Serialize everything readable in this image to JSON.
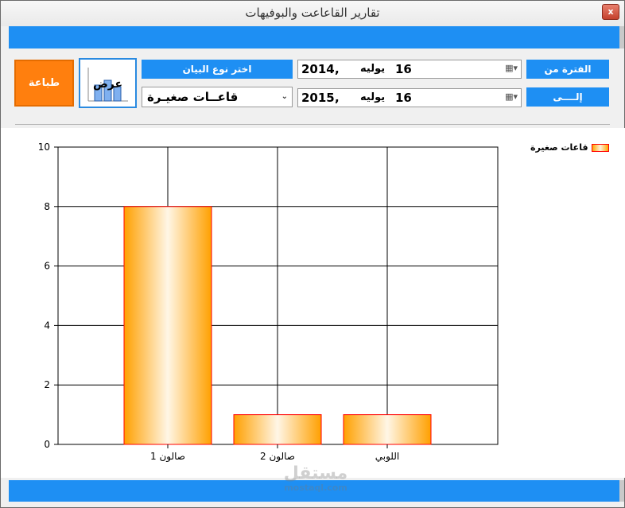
{
  "window": {
    "title": "تقارير القاعاعت والبوفيهات",
    "close_label": "x"
  },
  "toolbar": {
    "print_label": "طباعة",
    "show_label": "عرض",
    "choose_type_label": "اختر نوع البيان",
    "selected_type": "قاعــات صغيـرة",
    "from_label": "الفترة من",
    "to_label": "إلــــى"
  },
  "dates": {
    "from": {
      "year": "2014",
      "comma": ",",
      "month": "يوليه",
      "day": "16"
    },
    "to": {
      "year": "2015",
      "comma": ",",
      "month": "يوليه",
      "day": "16"
    }
  },
  "legend": {
    "label": "قاعات صغيرة"
  },
  "colors": {
    "accent": "#1e8ff3",
    "print": "#ff7f0e",
    "bar": "#ffa500",
    "bar_border": "#ff0000"
  },
  "watermark": {
    "brand": "مستقل",
    "site": "mostaql.com"
  },
  "chart_data": {
    "type": "bar",
    "categories": [
      "صالون 1",
      "صالون 2",
      "اللوبي"
    ],
    "series": [
      {
        "name": "قاعات صغيرة",
        "values": [
          8,
          1,
          1
        ]
      }
    ],
    "ylim": [
      0,
      10
    ],
    "yticks": [
      0,
      2,
      4,
      6,
      8,
      10
    ],
    "grid": true,
    "legend": "top-right"
  }
}
